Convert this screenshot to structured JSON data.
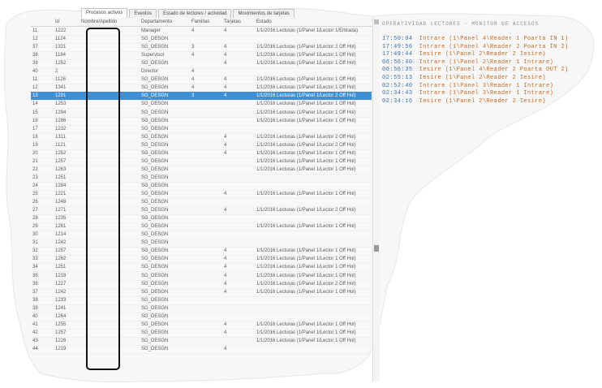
{
  "tabs": [
    "Procesos activos",
    "Eventos",
    "Estado de lectores / actividad",
    "Movimientos de tarjetas"
  ],
  "grid": {
    "headers": [
      "Id",
      "Nombre/Apellido",
      "Departamento",
      "Familias",
      "Tarjetas",
      "Estado"
    ],
    "rows": [
      [
        "11",
        "1222",
        "",
        "Manager",
        "4",
        "4",
        "1/1/2016  Lecturas (1/Panel 1/Lector 1/Entrada)"
      ],
      [
        "12",
        "1124",
        "",
        "SG_DESGN",
        "",
        "",
        ""
      ],
      [
        "37",
        "1321",
        "",
        "SG_DESGN",
        "3",
        "4",
        "1/1/2016  Lecturas (1/Panel 1/Lector 2 Off Hol)"
      ],
      [
        "38",
        "1184",
        "",
        "Supervisor",
        "4",
        "4",
        "1/1/2016  Lecturas (1/Panel 1/Lector 1 Off Hol)"
      ],
      [
        "39",
        "1252",
        "",
        "SG_DESGN",
        "",
        "4",
        "1/1/2016  Lecturas (1/Panel 1/Lector 1 Off Hol)"
      ],
      [
        "40",
        "2",
        "",
        "Director",
        "4",
        "",
        ""
      ],
      [
        "11",
        "1126",
        "",
        "SG_DESGN",
        "4",
        "4",
        "1/1/2016  Lecturas (1/Panel 1/Lector 1 Off Hol)"
      ],
      [
        "12",
        "1341",
        "",
        "SG_DESGN",
        "4",
        "4",
        "1/1/2016  Lecturas (1/Panel 1/Lector 1 Off Hol)"
      ],
      [
        "13",
        "1291",
        "",
        "SG_DESGN",
        "3",
        "4",
        "1/1/2016  Lecturas (1/Panel 1/Lector 2 Off Hol)"
      ],
      [
        "14",
        "1253",
        "",
        "SG_DESGN",
        "",
        "",
        "1/1/2016  Lecturas (1/Panel 1/Lector 1 Off Hol)"
      ],
      [
        "15",
        "1294",
        "",
        "SG_DESGN",
        "",
        "",
        "1/1/2016  Lecturas (1/Panel 1/Lector 1 Off Hol)"
      ],
      [
        "16",
        "1286",
        "",
        "SG_DESGN",
        "",
        "",
        "1/1/2016  Lecturas (1/Panel 1/Lector 1 Off Hol)"
      ],
      [
        "17",
        "1232",
        "",
        "SG_DESGN",
        "",
        "",
        ""
      ],
      [
        "18",
        "1311",
        "",
        "SG_DESGN",
        "",
        "4",
        "1/1/2016  Lecturas (1/Panel 1/Lector 2 Off Hol)"
      ],
      [
        "19",
        "1121",
        "",
        "SG_DESGN",
        "",
        "4",
        "1/1/2016  Lecturas (1/Panel 1/Lector 2 Off Hol)"
      ],
      [
        "20",
        "1252",
        "",
        "SG_DESGN",
        "",
        "4",
        "1/1/2016  Lecturas (1/Panel 1/Lector 1 Off Hol)"
      ],
      [
        "21",
        "1257",
        "",
        "SG_DESGN",
        "",
        "",
        "1/1/2016  Lecturas (1/Panel 1/Lector 1 Off Hol)"
      ],
      [
        "22",
        "1263",
        "",
        "SG_DESGN",
        "",
        "",
        "1/1/2016  Lecturas (1/Panel 1/Lector 1 Off Hol)"
      ],
      [
        "23",
        "1251",
        "",
        "SG_DESGN",
        "",
        "",
        ""
      ],
      [
        "24",
        "1284",
        "",
        "SG_DESGN",
        "",
        "",
        ""
      ],
      [
        "25",
        "1221",
        "",
        "SG_DESGN",
        "",
        "4",
        "1/1/2016  Lecturas (1/Panel 1/Lector 1 Off Hol)"
      ],
      [
        "26",
        "1248",
        "",
        "SG_DESGN",
        "",
        "",
        ""
      ],
      [
        "27",
        "1271",
        "",
        "SG_DESGN",
        "",
        "4",
        "1/1/2016  Lecturas (1/Panel 1/Lector 2 Off Hol)"
      ],
      [
        "28",
        "1235",
        "",
        "SG_DESGN",
        "",
        "",
        ""
      ],
      [
        "29",
        "1261",
        "",
        "SG_DESGN",
        "",
        "",
        "1/1/2016  Lecturas (1/Panel 1/Lector 1 Off Hol)"
      ],
      [
        "30",
        "1214",
        "",
        "SG_DESGN",
        "",
        "",
        ""
      ],
      [
        "31",
        "1242",
        "",
        "SG_DESGN",
        "",
        "",
        ""
      ],
      [
        "32",
        "1257",
        "",
        "SG_DESGN",
        "",
        "4",
        "1/1/2016  Lecturas (1/Panel 1/Lector 1 Off Hol)"
      ],
      [
        "33",
        "1262",
        "",
        "SG_DESGN",
        "",
        "4",
        "1/1/2016  Lecturas (1/Panel 1/Lector 1 Off Hol)"
      ],
      [
        "34",
        "1251",
        "",
        "SG_DESGN",
        "",
        "4",
        "1/1/2016  Lecturas (1/Panel 1/Lector 1 Off Hol)"
      ],
      [
        "35",
        "1218",
        "",
        "SG_DESGN",
        "",
        "4",
        "1/1/2016  Lecturas (1/Panel 1/Lector 1 Off Hol)"
      ],
      [
        "36",
        "1227",
        "",
        "SG_DESGN",
        "",
        "4",
        "1/1/2016  Lecturas (1/Panel 1/Lector 2 Off Hol)"
      ],
      [
        "37",
        "1242",
        "",
        "SG_DESGN",
        "",
        "4",
        "1/1/2016  Lecturas (1/Panel 1/Lector 1 Off Hol)"
      ],
      [
        "38",
        "1233",
        "",
        "SG_DESGN",
        "",
        "",
        ""
      ],
      [
        "39",
        "1241",
        "",
        "SG_DESGN",
        "",
        "",
        ""
      ],
      [
        "40",
        "1264",
        "",
        "SG_DESGN",
        "",
        "",
        ""
      ],
      [
        "41",
        "1255",
        "",
        "SG_DESGN",
        "",
        "4",
        "1/1/2016  Lecturas (1/Panel 1/Lector 1 Off Hol)"
      ],
      [
        "42",
        "1257",
        "",
        "SG_DESGN",
        "",
        "4",
        "1/1/2016  Lecturas (1/Panel 1/Lector 1 Off Hol)"
      ],
      [
        "43",
        "1226",
        "",
        "SG_DESGN",
        "",
        "",
        "1/1/2016  Lecturas (1/Panel 1/Lector 1 Off Hol)"
      ],
      [
        "44",
        "1219",
        "",
        "SG_DESGN",
        "",
        "4",
        ""
      ]
    ]
  },
  "log": {
    "title": "OPERATIVIDAD LECTORES · MONITOR DE ACCESOS",
    "lines": [
      {
        "time": "17:50:04",
        "msg": "Intrare (1\\Panel 4\\Reader 1 Poarta IN 1)"
      },
      {
        "time": "17:49:56",
        "msg": "Intrare (1\\Panel 4\\Reader 2 Poarta IN 2)"
      },
      {
        "time": "17:49:44",
        "msg": "Iesire (1\\Panel 2\\Reader 2 Iesire)"
      },
      {
        "time": "06:56:40",
        "msg": "Intrare (1\\Panel 2\\Reader 1 Intrare)"
      },
      {
        "time": "06:56:35",
        "msg": "Iesire (1\\Panel 4\\Reader 2 Poarta OUT 2)"
      },
      {
        "time": "02:55:13",
        "msg": "Iesire (1\\Panel 2\\Reader 2 Iesire)"
      },
      {
        "time": "02:52:40",
        "msg": "Intrare (1\\Panel 3\\Reader 1 Intrare)"
      },
      {
        "time": "02:34:43",
        "msg": "Intrare (1\\Panel 3\\Reader 1 Intrare)"
      },
      {
        "time": "02:34:16",
        "msg": "Iesire (1\\Panel 2\\Reader 2 Iesire)"
      }
    ]
  }
}
